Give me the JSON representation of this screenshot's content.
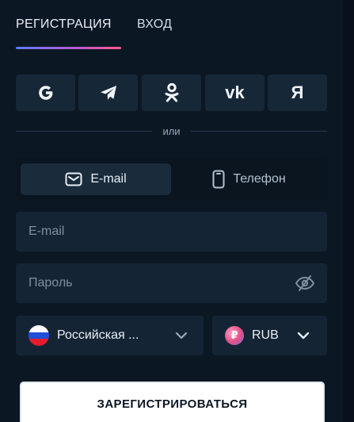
{
  "tabs": {
    "register": "РЕГИСТРАЦИЯ",
    "login": "ВХОД",
    "active": "register"
  },
  "social": [
    {
      "name": "google",
      "icon": "google-icon"
    },
    {
      "name": "telegram",
      "icon": "telegram-icon"
    },
    {
      "name": "odnoklassniki",
      "icon": "odnoklassniki-icon"
    },
    {
      "name": "vk",
      "icon": "vk-icon",
      "label": "vk"
    },
    {
      "name": "yandex",
      "icon": "yandex-icon",
      "label": "Я"
    }
  ],
  "divider_text": "или",
  "method": {
    "email_label": "E-mail",
    "phone_label": "Телефон",
    "active": "email"
  },
  "form": {
    "email_placeholder": "E-mail",
    "password_placeholder": "Пароль",
    "email_value": "",
    "password_value": ""
  },
  "country": {
    "label": "Российская ...",
    "flag_colors": [
      "#ffffff",
      "#1f4fd8",
      "#e11d2e"
    ]
  },
  "currency": {
    "label": "RUB",
    "coin_symbol": "₽"
  },
  "submit_label": "ЗАРЕГИСТРИРОВАТЬСЯ",
  "colors": {
    "background": "#0c1724",
    "field": "#142434",
    "accent_gradient": [
      "#5a7bff",
      "#b65ad8",
      "#ff5a86"
    ]
  }
}
